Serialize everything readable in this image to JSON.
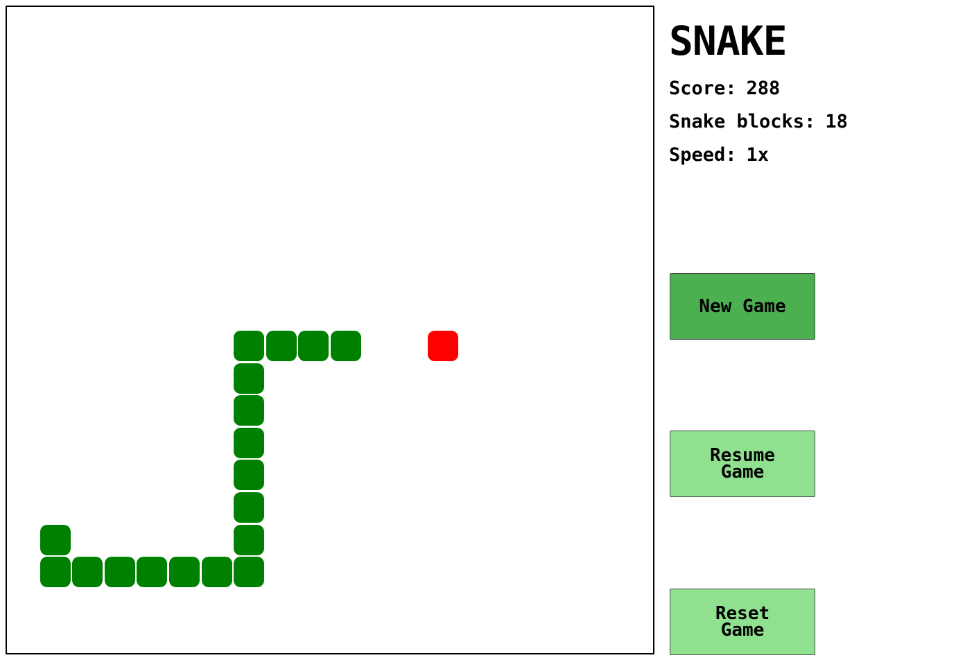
{
  "game": {
    "title": "SNAKE",
    "stats": {
      "score_label": "Score:",
      "score_value": "288",
      "blocks_label": "Snake blocks:",
      "blocks_value": "18",
      "speed_label": "Speed:",
      "speed_value": "1x"
    },
    "buttons": {
      "new_game": "New Game",
      "resume_game": "Resume Game",
      "reset_game": "Reset Game"
    },
    "board": {
      "grid_size": 20,
      "snake_color": "#008000",
      "food_color": "#ff0000",
      "snake_cells": [
        [
          10,
          10
        ],
        [
          9,
          10
        ],
        [
          8,
          10
        ],
        [
          7,
          10
        ],
        [
          7,
          11
        ],
        [
          7,
          12
        ],
        [
          7,
          13
        ],
        [
          7,
          14
        ],
        [
          7,
          15
        ],
        [
          7,
          16
        ],
        [
          7,
          17
        ],
        [
          6,
          17
        ],
        [
          5,
          17
        ],
        [
          4,
          17
        ],
        [
          3,
          17
        ],
        [
          2,
          17
        ],
        [
          1,
          17
        ],
        [
          1,
          16
        ]
      ],
      "food_cell": [
        13,
        10
      ]
    }
  }
}
